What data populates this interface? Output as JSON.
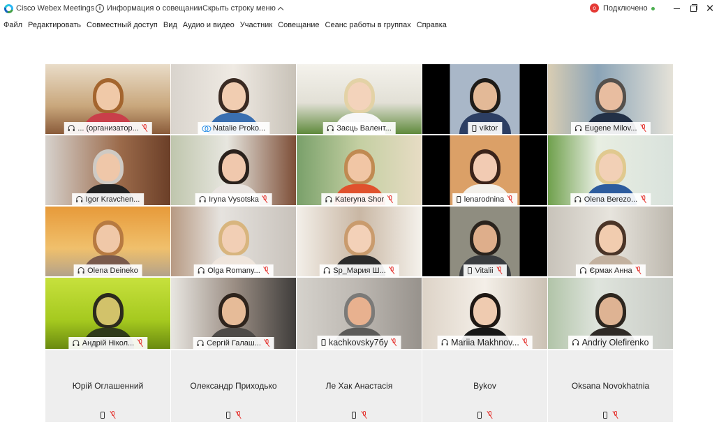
{
  "window": {
    "app_title": "Cisco Webex Meetings",
    "info_label": "Информация о совещании",
    "hide_bar_label": "Скрыть строку меню",
    "status_label": "Подключено",
    "rec_badge": "o"
  },
  "menu": [
    "Файл",
    "Редактировать",
    "Совместный доступ",
    "Вид",
    "Аудио и видео",
    "Участник",
    "Совещание",
    "Сеанс работы в группах",
    "Справка"
  ],
  "participants": [
    {
      "name": "... (организатор...",
      "device": "headset",
      "muted": true
    },
    {
      "name": "Natalie Proko...",
      "device": "web",
      "muted": false
    },
    {
      "name": "Заєць Валент...",
      "device": "headset",
      "muted": false
    },
    {
      "name": "viktor",
      "device": "phone",
      "muted": false
    },
    {
      "name": "Eugene Milov...",
      "device": "headset",
      "muted": true
    },
    {
      "name": "Igor Kravchen...",
      "device": "headset",
      "muted": false
    },
    {
      "name": "Iryna Vysotska",
      "device": "headset",
      "muted": true
    },
    {
      "name": "Kateryna Shor",
      "device": "headset",
      "muted": true
    },
    {
      "name": "lenarodnina",
      "device": "phone",
      "muted": true
    },
    {
      "name": "Olena Berezo...",
      "device": "headset",
      "muted": true
    },
    {
      "name": "Olena Deineko",
      "device": "headset",
      "muted": false
    },
    {
      "name": "Olga Romany...",
      "device": "headset",
      "muted": true
    },
    {
      "name": "Sp_Мария Ш...",
      "device": "headset",
      "muted": true
    },
    {
      "name": "Vitalii",
      "device": "phone",
      "muted": true
    },
    {
      "name": "Єрмак Анна",
      "device": "headset",
      "muted": true
    },
    {
      "name": "Андрій Нікол...",
      "device": "headset",
      "muted": true
    },
    {
      "name": "Сергій Галаш...",
      "device": "headset",
      "muted": true
    },
    {
      "name": "kachkovsky7бy",
      "device": "phone",
      "muted": true
    },
    {
      "name": "Mariia Makhnov...",
      "device": "headset",
      "muted": true
    },
    {
      "name": "Andriy Olefirenko",
      "device": "headset",
      "muted": false
    }
  ],
  "audio_only": [
    {
      "name": "Юрій Оглашенний"
    },
    {
      "name": "Олександр Приходько"
    },
    {
      "name": "Ле Хак Анастасія"
    },
    {
      "name": "Bykov"
    },
    {
      "name": "Oksana Novokhatnia"
    }
  ]
}
